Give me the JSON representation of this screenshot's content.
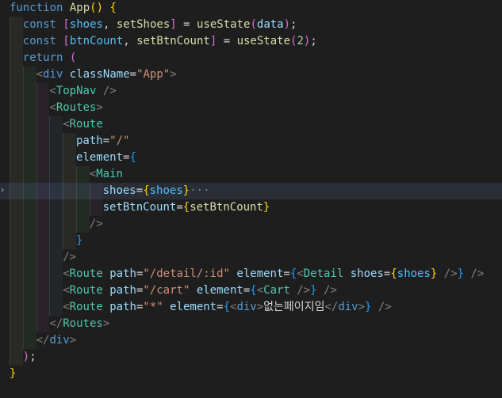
{
  "editor": {
    "current_line": 11,
    "lines": [
      {
        "indent": 0,
        "tokens": [
          {
            "t": "function",
            "c": "kw"
          },
          {
            "t": " ",
            "c": "plain"
          },
          {
            "t": "App",
            "c": "fn"
          },
          {
            "t": "()",
            "c": "b1"
          },
          {
            "t": " ",
            "c": "plain"
          },
          {
            "t": "{",
            "c": "b1"
          }
        ]
      },
      {
        "indent": 1,
        "tokens": [
          {
            "t": "const",
            "c": "kw"
          },
          {
            "t": " ",
            "c": "plain"
          },
          {
            "t": "[",
            "c": "b2"
          },
          {
            "t": "shoes",
            "c": "const"
          },
          {
            "t": ", ",
            "c": "plain"
          },
          {
            "t": "setShoes",
            "c": "fn"
          },
          {
            "t": "]",
            "c": "b2"
          },
          {
            "t": " = ",
            "c": "plain"
          },
          {
            "t": "useState",
            "c": "fn"
          },
          {
            "t": "(",
            "c": "b2"
          },
          {
            "t": "data",
            "c": "var"
          },
          {
            "t": ")",
            "c": "b2"
          },
          {
            "t": ";",
            "c": "plain"
          }
        ]
      },
      {
        "indent": 1,
        "tokens": [
          {
            "t": "const",
            "c": "kw"
          },
          {
            "t": " ",
            "c": "plain"
          },
          {
            "t": "[",
            "c": "b2"
          },
          {
            "t": "btnCount",
            "c": "const"
          },
          {
            "t": ", ",
            "c": "plain"
          },
          {
            "t": "setBtnCount",
            "c": "fn"
          },
          {
            "t": "]",
            "c": "b2"
          },
          {
            "t": " = ",
            "c": "plain"
          },
          {
            "t": "useState",
            "c": "fn"
          },
          {
            "t": "(",
            "c": "b2"
          },
          {
            "t": "2",
            "c": "num"
          },
          {
            "t": ")",
            "c": "b2"
          },
          {
            "t": ";",
            "c": "plain"
          }
        ]
      },
      {
        "indent": 1,
        "tokens": [
          {
            "t": "return",
            "c": "kw"
          },
          {
            "t": " ",
            "c": "plain"
          },
          {
            "t": "(",
            "c": "b2"
          }
        ]
      },
      {
        "indent": 2,
        "tokens": [
          {
            "t": "<",
            "c": "tagp"
          },
          {
            "t": "div",
            "c": "kw"
          },
          {
            "t": " ",
            "c": "plain"
          },
          {
            "t": "className",
            "c": "attr"
          },
          {
            "t": "=",
            "c": "plain"
          },
          {
            "t": "\"App\"",
            "c": "str"
          },
          {
            "t": ">",
            "c": "tagp"
          }
        ]
      },
      {
        "indent": 3,
        "tokens": [
          {
            "t": "<",
            "c": "tagp"
          },
          {
            "t": "TopNav",
            "c": "tag"
          },
          {
            "t": " />",
            "c": "tagp"
          }
        ]
      },
      {
        "indent": 3,
        "tokens": [
          {
            "t": "<",
            "c": "tagp"
          },
          {
            "t": "Routes",
            "c": "tag"
          },
          {
            "t": ">",
            "c": "tagp"
          }
        ]
      },
      {
        "indent": 4,
        "tokens": [
          {
            "t": "<",
            "c": "tagp"
          },
          {
            "t": "Route",
            "c": "tag"
          }
        ]
      },
      {
        "indent": 5,
        "tokens": [
          {
            "t": "path",
            "c": "attr"
          },
          {
            "t": "=",
            "c": "plain"
          },
          {
            "t": "\"/\"",
            "c": "str"
          }
        ]
      },
      {
        "indent": 5,
        "tokens": [
          {
            "t": "element",
            "c": "attr"
          },
          {
            "t": "=",
            "c": "plain"
          },
          {
            "t": "{",
            "c": "b3"
          }
        ]
      },
      {
        "indent": 6,
        "tokens": [
          {
            "t": "<",
            "c": "tagp"
          },
          {
            "t": "Main",
            "c": "tag"
          }
        ]
      },
      {
        "indent": 7,
        "tokens": [
          {
            "t": "shoes",
            "c": "attr"
          },
          {
            "t": "=",
            "c": "plain"
          },
          {
            "t": "{",
            "c": "b1"
          },
          {
            "t": "shoes",
            "c": "const"
          },
          {
            "t": "}",
            "c": "b1"
          },
          {
            "t": "···",
            "c": "fold-dots"
          }
        ]
      },
      {
        "indent": 7,
        "tokens": [
          {
            "t": "setBtnCount",
            "c": "attr"
          },
          {
            "t": "=",
            "c": "plain"
          },
          {
            "t": "{",
            "c": "b1"
          },
          {
            "t": "setBtnCount",
            "c": "fn"
          },
          {
            "t": "}",
            "c": "b1"
          }
        ]
      },
      {
        "indent": 6,
        "tokens": [
          {
            "t": "/>",
            "c": "tagp"
          }
        ]
      },
      {
        "indent": 5,
        "tokens": [
          {
            "t": "}",
            "c": "b3"
          }
        ]
      },
      {
        "indent": 4,
        "tokens": [
          {
            "t": "/>",
            "c": "tagp"
          }
        ]
      },
      {
        "indent": 4,
        "tokens": [
          {
            "t": "<",
            "c": "tagp"
          },
          {
            "t": "Route",
            "c": "tag"
          },
          {
            "t": " ",
            "c": "plain"
          },
          {
            "t": "path",
            "c": "attr"
          },
          {
            "t": "=",
            "c": "plain"
          },
          {
            "t": "\"/detail/:id\"",
            "c": "str"
          },
          {
            "t": " ",
            "c": "plain"
          },
          {
            "t": "element",
            "c": "attr"
          },
          {
            "t": "=",
            "c": "plain"
          },
          {
            "t": "{",
            "c": "b3"
          },
          {
            "t": "<",
            "c": "tagp"
          },
          {
            "t": "Detail",
            "c": "tag"
          },
          {
            "t": " ",
            "c": "plain"
          },
          {
            "t": "shoes",
            "c": "attr"
          },
          {
            "t": "=",
            "c": "plain"
          },
          {
            "t": "{",
            "c": "b1"
          },
          {
            "t": "shoes",
            "c": "const"
          },
          {
            "t": "}",
            "c": "b1"
          },
          {
            "t": " />",
            "c": "tagp"
          },
          {
            "t": "}",
            "c": "b3"
          },
          {
            "t": " />",
            "c": "tagp"
          }
        ]
      },
      {
        "indent": 4,
        "tokens": [
          {
            "t": "<",
            "c": "tagp"
          },
          {
            "t": "Route",
            "c": "tag"
          },
          {
            "t": " ",
            "c": "plain"
          },
          {
            "t": "path",
            "c": "attr"
          },
          {
            "t": "=",
            "c": "plain"
          },
          {
            "t": "\"/cart\"",
            "c": "str"
          },
          {
            "t": " ",
            "c": "plain"
          },
          {
            "t": "element",
            "c": "attr"
          },
          {
            "t": "=",
            "c": "plain"
          },
          {
            "t": "{",
            "c": "b3"
          },
          {
            "t": "<",
            "c": "tagp"
          },
          {
            "t": "Cart",
            "c": "tag"
          },
          {
            "t": " />",
            "c": "tagp"
          },
          {
            "t": "}",
            "c": "b3"
          },
          {
            "t": " />",
            "c": "tagp"
          }
        ]
      },
      {
        "indent": 4,
        "tokens": [
          {
            "t": "<",
            "c": "tagp"
          },
          {
            "t": "Route",
            "c": "tag"
          },
          {
            "t": " ",
            "c": "plain"
          },
          {
            "t": "path",
            "c": "attr"
          },
          {
            "t": "=",
            "c": "plain"
          },
          {
            "t": "\"*\"",
            "c": "str"
          },
          {
            "t": " ",
            "c": "plain"
          },
          {
            "t": "element",
            "c": "attr"
          },
          {
            "t": "=",
            "c": "plain"
          },
          {
            "t": "{",
            "c": "b3"
          },
          {
            "t": "<",
            "c": "tagp"
          },
          {
            "t": "div",
            "c": "kw"
          },
          {
            "t": ">",
            "c": "tagp"
          },
          {
            "t": "없는페이지임",
            "c": "plain"
          },
          {
            "t": "</",
            "c": "tagp"
          },
          {
            "t": "div",
            "c": "kw"
          },
          {
            "t": ">",
            "c": "tagp"
          },
          {
            "t": "}",
            "c": "b3"
          },
          {
            "t": " />",
            "c": "tagp"
          }
        ]
      },
      {
        "indent": 3,
        "tokens": [
          {
            "t": "</",
            "c": "tagp"
          },
          {
            "t": "Routes",
            "c": "tag"
          },
          {
            "t": ">",
            "c": "tagp"
          }
        ]
      },
      {
        "indent": 2,
        "tokens": [
          {
            "t": "</",
            "c": "tagp"
          },
          {
            "t": "div",
            "c": "kw"
          },
          {
            "t": ">",
            "c": "tagp"
          }
        ]
      },
      {
        "indent": 1,
        "tokens": [
          {
            "t": ")",
            "c": "b2"
          },
          {
            "t": ";",
            "c": "plain"
          }
        ]
      },
      {
        "indent": 0,
        "tokens": [
          {
            "t": "}",
            "c": "b1"
          }
        ]
      }
    ]
  }
}
